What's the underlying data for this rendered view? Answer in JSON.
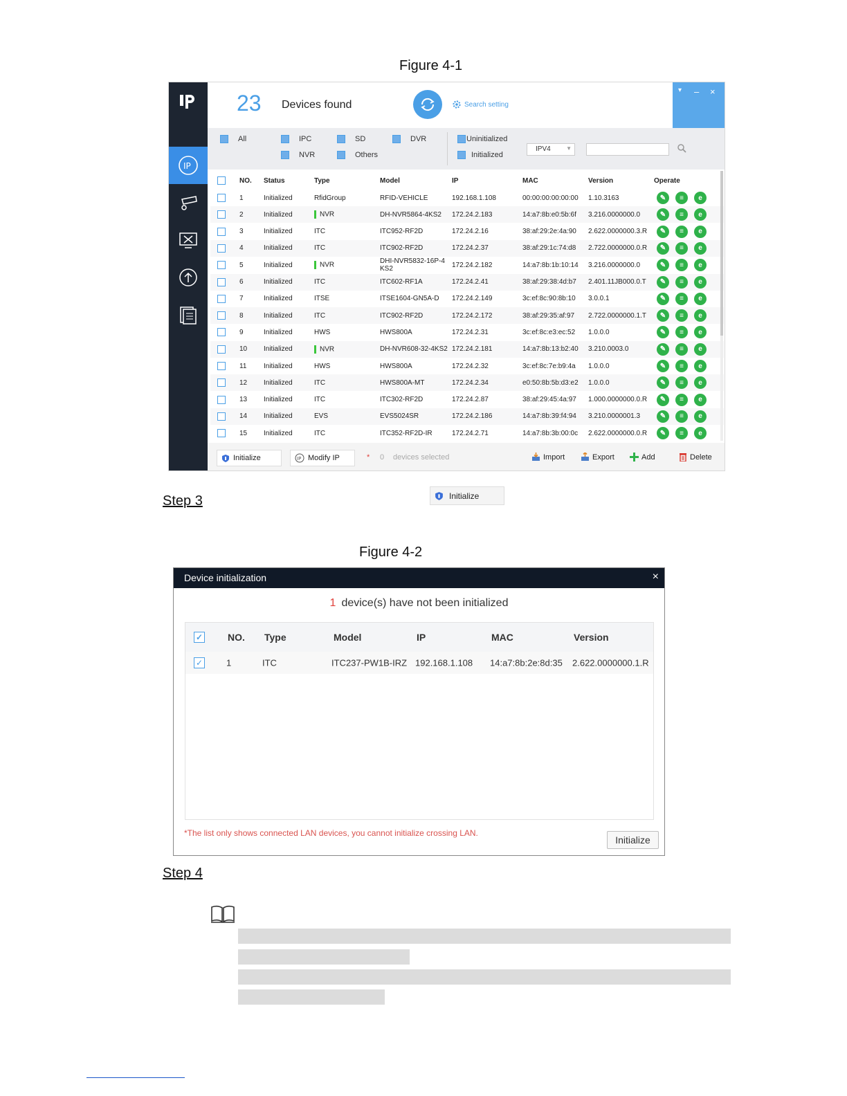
{
  "figure1": {
    "caption": "Figure 4-1",
    "logo": "lp",
    "device_count": "23",
    "devices_found_label": "Devices found",
    "search_setting_label": "Search setting",
    "window_controls": {
      "menu": "▾",
      "minimize": "–",
      "close": "×"
    },
    "filters": {
      "all": "All",
      "ipc": "IPC",
      "sd": "SD",
      "dvr": "DVR",
      "nvr": "NVR",
      "others": "Others",
      "uninitialized": "Uninitialized",
      "initialized": "Initialized",
      "ip_version": "IPV4"
    },
    "columns": {
      "no": "NO.",
      "status": "Status",
      "type": "Type",
      "model": "Model",
      "ip": "IP",
      "mac": "MAC",
      "version": "Version",
      "operate": "Operate"
    },
    "rows": [
      {
        "no": "1",
        "status": "Initialized",
        "type": "RfidGroup",
        "model": "RFID-VEHICLE",
        "ip": "192.168.1.108",
        "mac": "00:00:00:00:00:00",
        "version": "1.10.3163",
        "nvr": false
      },
      {
        "no": "2",
        "status": "Initialized",
        "type": "NVR",
        "model": "DH-NVR5864-4KS2",
        "ip": "172.24.2.183",
        "mac": "14:a7:8b:e0:5b:6f",
        "version": "3.216.0000000.0",
        "nvr": true
      },
      {
        "no": "3",
        "status": "Initialized",
        "type": "ITC",
        "model": "ITC952-RF2D",
        "ip": "172.24.2.16",
        "mac": "38:af:29:2e:4a:90",
        "version": "2.622.0000000.3.R",
        "nvr": false
      },
      {
        "no": "4",
        "status": "Initialized",
        "type": "ITC",
        "model": "ITC902-RF2D",
        "ip": "172.24.2.37",
        "mac": "38:af:29:1c:74:d8",
        "version": "2.722.0000000.0.R",
        "nvr": false
      },
      {
        "no": "5",
        "status": "Initialized",
        "type": "NVR",
        "model": "DHI-NVR5832-16P-4KS2",
        "ip": "172.24.2.182",
        "mac": "14:a7:8b:1b:10:14",
        "version": "3.216.0000000.0",
        "nvr": true
      },
      {
        "no": "6",
        "status": "Initialized",
        "type": "ITC",
        "model": "ITC602-RF1A",
        "ip": "172.24.2.41",
        "mac": "38:af:29:38:4d:b7",
        "version": "2.401.11JB000.0.T",
        "nvr": false
      },
      {
        "no": "7",
        "status": "Initialized",
        "type": "ITSE",
        "model": "ITSE1604-GN5A-D",
        "ip": "172.24.2.149",
        "mac": "3c:ef:8c:90:8b:10",
        "version": "3.0.0.1",
        "nvr": false
      },
      {
        "no": "8",
        "status": "Initialized",
        "type": "ITC",
        "model": "ITC902-RF2D",
        "ip": "172.24.2.172",
        "mac": "38:af:29:35:af:97",
        "version": "2.722.0000000.1.T",
        "nvr": false
      },
      {
        "no": "9",
        "status": "Initialized",
        "type": "HWS",
        "model": "HWS800A",
        "ip": "172.24.2.31",
        "mac": "3c:ef:8c:e3:ec:52",
        "version": "1.0.0.0",
        "nvr": false
      },
      {
        "no": "10",
        "status": "Initialized",
        "type": "NVR",
        "model": "DH-NVR608-32-4KS2",
        "ip": "172.24.2.181",
        "mac": "14:a7:8b:13:b2:40",
        "version": "3.210.0003.0",
        "nvr": true
      },
      {
        "no": "11",
        "status": "Initialized",
        "type": "HWS",
        "model": "HWS800A",
        "ip": "172.24.2.32",
        "mac": "3c:ef:8c:7e:b9:4a",
        "version": "1.0.0.0",
        "nvr": false
      },
      {
        "no": "12",
        "status": "Initialized",
        "type": "ITC",
        "model": "HWS800A-MT",
        "ip": "172.24.2.34",
        "mac": "e0:50:8b:5b:d3:e2",
        "version": "1.0.0.0",
        "nvr": false
      },
      {
        "no": "13",
        "status": "Initialized",
        "type": "ITC",
        "model": "ITC302-RF2D",
        "ip": "172.24.2.87",
        "mac": "38:af:29:45:4a:97",
        "version": "1.000.0000000.0.R",
        "nvr": false
      },
      {
        "no": "14",
        "status": "Initialized",
        "type": "EVS",
        "model": "EVS5024SR",
        "ip": "172.24.2.186",
        "mac": "14:a7:8b:39:f4:94",
        "version": "3.210.0000001.3",
        "nvr": false
      },
      {
        "no": "15",
        "status": "Initialized",
        "type": "ITC",
        "model": "ITC352-RF2D-IR",
        "ip": "172.24.2.71",
        "mac": "14:a7:8b:3b:00:0c",
        "version": "2.622.0000000.0.R",
        "nvr": false
      }
    ],
    "bottom": {
      "initialize": "Initialize",
      "modify_ip": "Modify IP",
      "selected_star": "*",
      "selected_count": "0",
      "selected_label": "devices selected",
      "import": "Import",
      "export": "Export",
      "add": "Add",
      "delete": "Delete"
    }
  },
  "step3": {
    "label": "Step 3",
    "button": "Initialize"
  },
  "figure2": {
    "caption": "Figure 4-2",
    "title": "Device initialization",
    "close": "×",
    "message_count": "1",
    "message_text": "device(s) have not been initialized",
    "columns": {
      "no": "NO.",
      "type": "Type",
      "model": "Model",
      "ip": "IP",
      "mac": "MAC",
      "version": "Version"
    },
    "rows": [
      {
        "no": "1",
        "type": "ITC",
        "model": "ITC237-PW1B-IRZ",
        "ip": "192.168.1.108",
        "mac": "14:a7:8b:2e:8d:35",
        "version": "2.622.0000000.1.R"
      }
    ],
    "note": "*The list only shows connected LAN devices, you cannot initialize crossing LAN.",
    "button": "Initialize"
  },
  "step4": {
    "label": "Step 4"
  },
  "colors": {
    "accent": "#4a9fe6",
    "sidebar": "#1d2531",
    "operate_green": "#2fb24a",
    "warning_red": "#e0403a",
    "dialog_title": "#101927"
  }
}
